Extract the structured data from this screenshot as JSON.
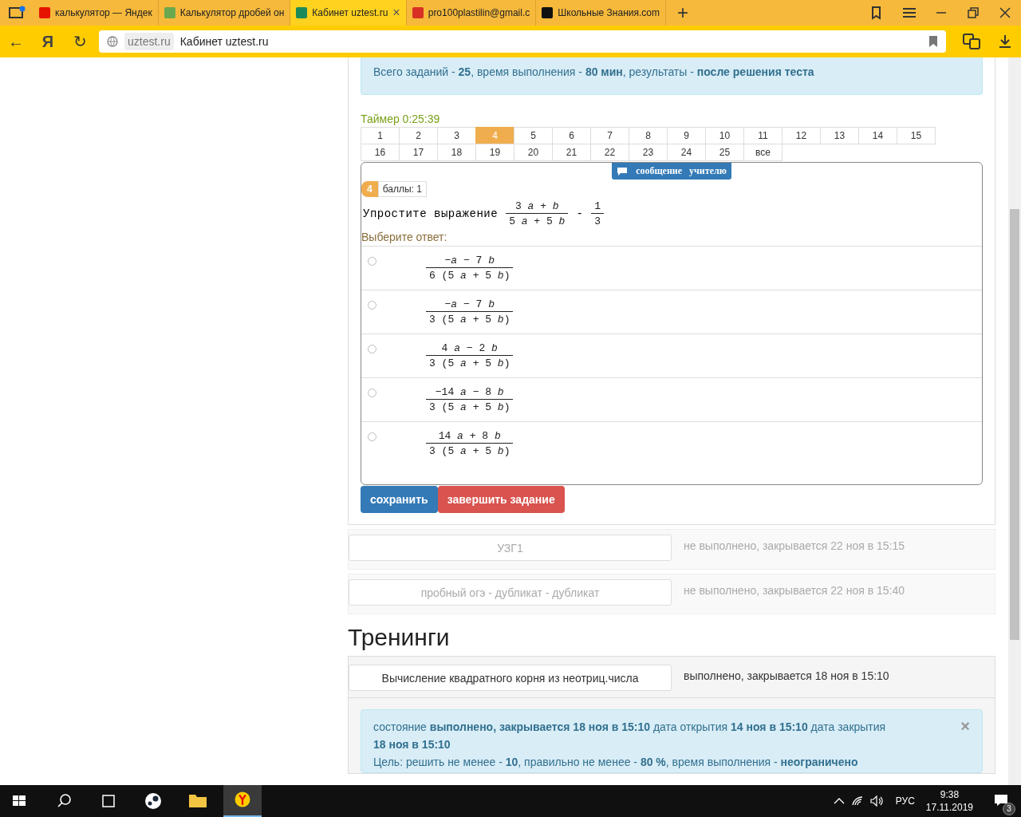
{
  "browser": {
    "tabs": [
      {
        "title": "калькулятор — Яндек",
        "kind": "yandex",
        "selected": false
      },
      {
        "title": "Калькулятор дробей он",
        "kind": "grid",
        "selected": false
      },
      {
        "title": "Кабинет uztest.ru",
        "kind": "uztest",
        "selected": true,
        "close": "×"
      },
      {
        "title": "pro100plastilin@gmail.c",
        "kind": "gmail",
        "selected": false
      },
      {
        "title": "Школьные Знания.com",
        "kind": "znania",
        "selected": false
      }
    ],
    "new_tab": "+",
    "back": "←",
    "yandex_button": "Я",
    "reload": "↻",
    "domain": "uztest.ru",
    "page_title": "Кабинет uztest.ru"
  },
  "summary": "Всего заданий - **25**, время выполнения - **80 мин**, результаты - **после решения теста**",
  "timer": "Таймер 0:25:39",
  "question_nav": [
    {
      "label": "1",
      "selected": false
    },
    {
      "label": "2",
      "selected": false
    },
    {
      "label": "3",
      "selected": false
    },
    {
      "label": "4",
      "selected": true
    },
    {
      "label": "5",
      "selected": false
    },
    {
      "label": "6",
      "selected": false
    },
    {
      "label": "7",
      "selected": false
    },
    {
      "label": "8",
      "selected": false
    },
    {
      "label": "9",
      "selected": false
    },
    {
      "label": "10",
      "selected": false
    },
    {
      "label": "11",
      "selected": false
    },
    {
      "label": "12",
      "selected": false
    },
    {
      "label": "13",
      "selected": false
    },
    {
      "label": "14",
      "selected": false
    },
    {
      "label": "15",
      "selected": false
    },
    {
      "label": "16",
      "selected": false
    },
    {
      "label": "17",
      "selected": false
    },
    {
      "label": "18",
      "selected": false
    },
    {
      "label": "19",
      "selected": false
    },
    {
      "label": "20",
      "selected": false
    },
    {
      "label": "21",
      "selected": false
    },
    {
      "label": "22",
      "selected": false
    },
    {
      "label": "23",
      "selected": false
    },
    {
      "label": "24",
      "selected": false
    },
    {
      "label": "25",
      "selected": false
    },
    {
      "label": "все",
      "selected": false
    }
  ],
  "message_button": "сообщение учителю",
  "question": {
    "number": "4",
    "points": "баллы: 1",
    "prompt": "Упростите выражение",
    "expression": {
      "fraction_1": {
        "numerator": "3 *a* + *b*",
        "denominator": "5 *a* + 5 *b*"
      },
      "operator": "-",
      "fraction_2": {
        "numerator": "1",
        "denominator": "3"
      }
    },
    "answer_prompt": "Выберите ответ:",
    "answers": [
      {
        "numerator": "−*a* − 7 *b*",
        "denominator": "6 (5 *a* + 5 *b*)",
        "selected": false
      },
      {
        "numerator": "−*a* − 7 *b*",
        "denominator": "3 (5 *a* + 5 *b*)",
        "selected": false
      },
      {
        "numerator": "4 *a* − 2 *b*",
        "denominator": "3 (5 *a* + 5 *b*)",
        "selected": false
      },
      {
        "numerator": "−14 *a* − 8 *b*",
        "denominator": "3 (5 *a* + 5 *b*)",
        "selected": false
      },
      {
        "numerator": "14 *a* + 8 *b*",
        "denominator": "3 (5 *a* + 5 *b*)",
        "selected": false
      }
    ]
  },
  "buttons": {
    "save": "сохранить",
    "finish": "завершить задание"
  },
  "tests": [
    {
      "name": "УЗГ1",
      "status": "не выполнено, закрывается 22 ноя в 15:15",
      "disabled": true
    },
    {
      "name": "пробный огэ - дубликат - дубликат",
      "status": "не выполнено, закрывается 22 ноя в 15:40",
      "disabled": true
    }
  ],
  "trainings_heading": "Тренинги",
  "trainings": [
    {
      "name": "Вычисление квадратного корня из неотриц.числа",
      "status": "выполнено, закрывается 18 ноя в 15:10",
      "disabled": false
    }
  ],
  "training_info": {
    "lines": [
      "состояние **выполнено, закрывается 18 ноя в 15:10** дата открытия **14 ноя в 15:10** дата закрытия",
      "**18 ноя в 15:10**",
      "Цель: решить не менее - **10**, правильно не менее - **80 %**, время выполнения - **неограничено**"
    ],
    "close": "×"
  },
  "taskbar": {
    "language": "РУС",
    "time": "9:38",
    "date": "17.11.2019",
    "notifications": "3"
  }
}
